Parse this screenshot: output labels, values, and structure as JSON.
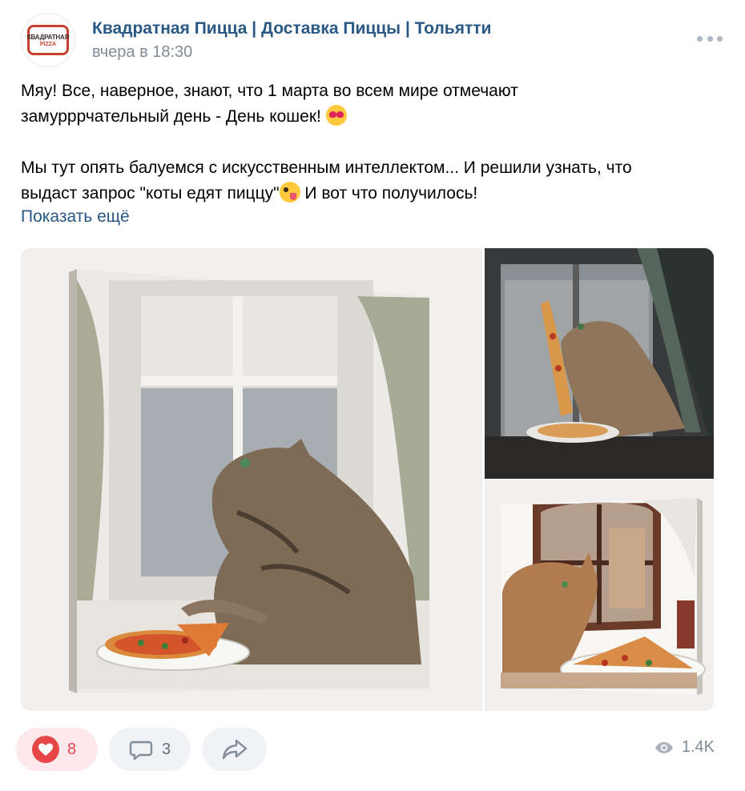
{
  "group": {
    "name": "Квадратная Пицца | Доставка Пиццы | Тольятти",
    "avatar_text_top": "КВАДРАТНАЯ",
    "avatar_text_bottom": "PIZZA",
    "time": "вчера в 18:30"
  },
  "post": {
    "line1": "Мяу! Все, наверное, знают, что 1 марта во всем мире отмечают",
    "line2": "замурррчательный день - День кошек!",
    "line2_emoji": "heart-eyes-emoji",
    "line3": "Мы тут опять балуемся с искусственным интеллектом... И решили узнать, что",
    "line4_a": "выдаст запрос \"коты едят пиццу\"",
    "line4_emoji": "zany-face-emoji",
    "line4_b": "И вот что получилось!",
    "show_more": "Показать ещё"
  },
  "photos": [
    {
      "alt": "cat-eating-pizza-by-window-canvas"
    },
    {
      "alt": "cat-eating-pizza-slice-at-rainy-window"
    },
    {
      "alt": "cat-with-pizza-and-cola-canvas"
    }
  ],
  "footer": {
    "likes": "8",
    "comments": "3",
    "views": "1.4K"
  },
  "colors": {
    "link": "#2a5885",
    "meta": "#818c99",
    "like": "#e64646",
    "button_bg": "#f0f2f5"
  }
}
